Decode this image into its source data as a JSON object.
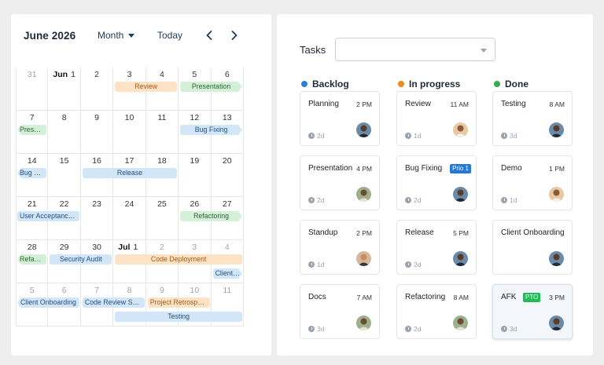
{
  "calendar": {
    "title": "June 2026",
    "view_label": "Month",
    "today_label": "Today",
    "weeks": [
      [
        {
          "d": "31",
          "muted": true
        },
        {
          "d": "1",
          "month": "Jun"
        },
        {
          "d": "2"
        },
        {
          "d": "3"
        },
        {
          "d": "4"
        },
        {
          "d": "5"
        },
        {
          "d": "6"
        }
      ],
      [
        {
          "d": "7"
        },
        {
          "d": "8"
        },
        {
          "d": "9"
        },
        {
          "d": "10"
        },
        {
          "d": "11"
        },
        {
          "d": "12"
        },
        {
          "d": "13"
        }
      ],
      [
        {
          "d": "14"
        },
        {
          "d": "15"
        },
        {
          "d": "16"
        },
        {
          "d": "17"
        },
        {
          "d": "18"
        },
        {
          "d": "19"
        },
        {
          "d": "20"
        }
      ],
      [
        {
          "d": "21"
        },
        {
          "d": "22"
        },
        {
          "d": "23"
        },
        {
          "d": "24"
        },
        {
          "d": "25"
        },
        {
          "d": "26"
        },
        {
          "d": "27"
        }
      ],
      [
        {
          "d": "28"
        },
        {
          "d": "29"
        },
        {
          "d": "30"
        },
        {
          "d": "1",
          "month": "Jul"
        },
        {
          "d": "2",
          "muted": true
        },
        {
          "d": "3",
          "muted": true
        },
        {
          "d": "4",
          "muted": true
        }
      ],
      [
        {
          "d": "5",
          "muted": true
        },
        {
          "d": "6",
          "muted": true
        },
        {
          "d": "7",
          "muted": true
        },
        {
          "d": "8",
          "muted": true
        },
        {
          "d": "9",
          "muted": true
        },
        {
          "d": "10",
          "muted": true
        },
        {
          "d": "11",
          "muted": true
        }
      ]
    ],
    "events": [
      {
        "label": "Review",
        "color": "orange",
        "week": 0,
        "start": 3,
        "span": 2,
        "lane": 0,
        "shape": ""
      },
      {
        "label": "Presentation",
        "color": "green",
        "week": 0,
        "start": 5,
        "span": 2,
        "lane": 0,
        "shape": "right"
      },
      {
        "label": "Presentation",
        "color": "green",
        "week": 1,
        "start": 0,
        "span": 1,
        "lane": 0,
        "shape": "left"
      },
      {
        "label": "Bug Fixing",
        "color": "blue",
        "week": 1,
        "start": 5,
        "span": 2,
        "lane": 0,
        "shape": "right"
      },
      {
        "label": "Bug Fixing",
        "color": "blue",
        "week": 2,
        "start": 0,
        "span": 1,
        "lane": 0,
        "shape": "left"
      },
      {
        "label": "Release",
        "color": "blue",
        "week": 2,
        "start": 2,
        "span": 3,
        "lane": 0,
        "shape": ""
      },
      {
        "label": "User Acceptance Testing",
        "color": "blue",
        "week": 3,
        "start": 0,
        "span": 2,
        "lane": 0,
        "shape": ""
      },
      {
        "label": "Refactoring",
        "color": "green",
        "week": 3,
        "start": 5,
        "span": 2,
        "lane": 0,
        "shape": "right"
      },
      {
        "label": "Refactoring",
        "color": "green",
        "week": 4,
        "start": 0,
        "span": 1,
        "lane": 0,
        "shape": "left"
      },
      {
        "label": "Security Audit",
        "color": "blue",
        "week": 4,
        "start": 1,
        "span": 2,
        "lane": 0,
        "shape": ""
      },
      {
        "label": "Code Deployment",
        "color": "orange",
        "week": 4,
        "start": 3,
        "span": 4,
        "lane": 0,
        "shape": ""
      },
      {
        "label": "Client Onboarding",
        "color": "blue",
        "week": 4,
        "start": 6,
        "span": 1,
        "lane": 1,
        "shape": "right"
      },
      {
        "label": "Client Onboarding",
        "color": "blue",
        "week": 5,
        "start": 0,
        "span": 2,
        "lane": 0,
        "shape": "left"
      },
      {
        "label": "Code Review Session",
        "color": "blue",
        "week": 5,
        "start": 2,
        "span": 2,
        "lane": 0,
        "shape": ""
      },
      {
        "label": "Project Retrospective",
        "color": "orange",
        "week": 5,
        "start": 4,
        "span": 2,
        "lane": 0,
        "shape": ""
      },
      {
        "label": "Testing",
        "color": "blue",
        "week": 5,
        "start": 3,
        "span": 4,
        "lane": 1,
        "shape": ""
      }
    ]
  },
  "tasks": {
    "label": "Tasks",
    "filter_value": "",
    "columns": [
      {
        "name": "Backlog",
        "color": "#2b7fd9",
        "cards": [
          {
            "title": "Planning",
            "time": "2 PM",
            "duration": "2d",
            "avatar": "a1"
          },
          {
            "title": "Presentation",
            "time": "4 PM",
            "duration": "2d",
            "avatar": "a2"
          },
          {
            "title": "Standup",
            "time": "2 PM",
            "duration": "1d",
            "avatar": "a3"
          },
          {
            "title": "Docs",
            "time": "7 AM",
            "duration": "3d",
            "avatar": "a2"
          }
        ]
      },
      {
        "name": "In progress",
        "color": "#f08a1c",
        "cards": [
          {
            "title": "Review",
            "time": "11 AM",
            "duration": "1d",
            "avatar": "a4"
          },
          {
            "title": "Bug Fixing",
            "badge": "Prio 1",
            "badge_color": "blue",
            "time": "",
            "duration": "2d",
            "avatar": "a1"
          },
          {
            "title": "Release",
            "time": "5 PM",
            "duration": "2d",
            "avatar": "a1"
          },
          {
            "title": "Refactoring",
            "time": "8 AM",
            "duration": "2d",
            "avatar": "a2"
          }
        ]
      },
      {
        "name": "Done",
        "color": "#3aa755",
        "cards": [
          {
            "title": "Testing",
            "time": "8 AM",
            "duration": "3d",
            "avatar": "a1"
          },
          {
            "title": "Demo",
            "time": "1 PM",
            "duration": "1d",
            "avatar": "a4"
          },
          {
            "title": "Client Onboarding",
            "time": "",
            "duration": "",
            "avatar": "a1"
          },
          {
            "title": "AFK",
            "badge": "PTO",
            "badge_color": "green",
            "time": "3 PM",
            "duration": "3d",
            "avatar": "a1",
            "highlight": true
          }
        ]
      }
    ]
  }
}
